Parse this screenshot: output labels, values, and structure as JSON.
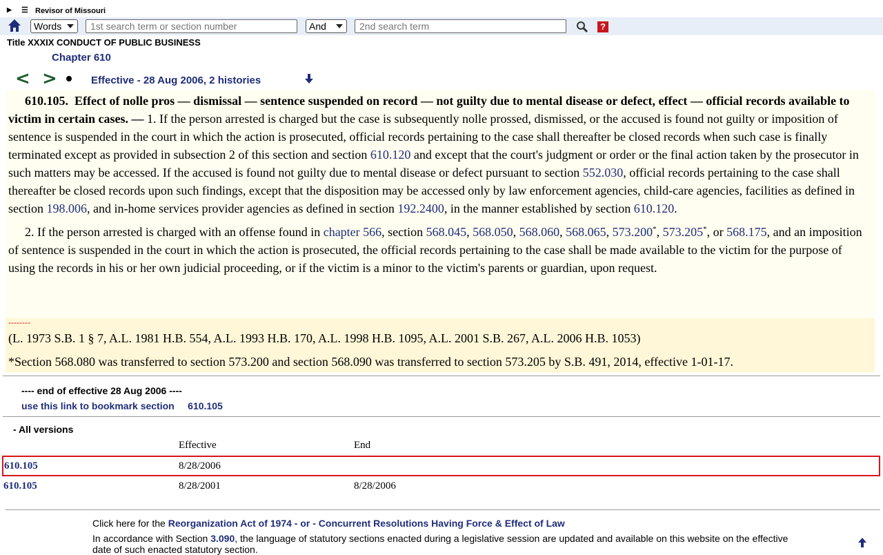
{
  "top": {
    "title": "Revisor of Missouri"
  },
  "search": {
    "mode_selected": "Words",
    "first_placeholder": "1st search term or section number",
    "operator_selected": "And",
    "second_placeholder": "2nd search term",
    "help_label": "?"
  },
  "heading": {
    "title": "Title XXXIX CONDUCT OF PUBLIC BUSINESS",
    "chapter": "Chapter 610"
  },
  "nav": {
    "prev": "<",
    "next": ">",
    "effective": "Effective - 28 Aug 2006, 2 histories"
  },
  "statute": {
    "section": "610.105.",
    "heading": "Effect of nolle pros — dismissal — sentence suspended on record — not guilty due to mental disease or defect, effect — official records available to victim in certain cases. —",
    "p1_a": " 1.  If the person arrested is charged but the case is subsequently nolle prossed, dismissed, or the accused is found not guilty or imposition of sentence is suspended in the court in which the action is prosecuted, official records pertaining to the case shall thereafter be closed records when such case is finally terminated except as provided in subsection 2 of this section and section ",
    "p1_link1": "610.120",
    "p1_b": " and except that the court's judgment or order or the final action taken by the prosecutor in such matters may be accessed.  If the accused is found not guilty due to mental disease or defect pursuant to section ",
    "p1_link2": "552.030",
    "p1_c": ", official records pertaining to the case shall thereafter be closed records upon such findings, except that the disposition may be accessed only by law enforcement agencies, child-care agencies, facilities as defined in section ",
    "p1_link3": "198.006",
    "p1_d": ", and in-home services provider agencies as defined in section ",
    "p1_link4": "192.2400",
    "p1_e": ", in the manner established by section ",
    "p1_link5": "610.120",
    "p1_f": ".",
    "p2_a": "2.  If the person arrested is charged with an offense found in ",
    "p2_link1": "chapter 566",
    "p2_b": ", section ",
    "p2_link2": "568.045",
    "p2_link3": "568.050",
    "p2_link4": "568.060",
    "p2_link5": "568.065",
    "p2_link6": "573.200",
    "p2_link7": "573.205",
    "p2_link8": "568.175",
    "p2_sep": ", ",
    "p2_or": ", or ",
    "p2_star": "*",
    "p2_c": ", and an imposition of sentence is suspended in the court in which the action is prosecuted, the official records pertaining to the case shall be made available to the victim for the purpose of using the records in his or her own judicial proceeding, or if the victim is a minor to the victim's parents or guardian, upon request."
  },
  "history": {
    "dashes": "--------",
    "acts": "(L. 1973 S.B. 1 § 7, A.L. 1981 H.B. 554, A.L. 1993 H.B. 170, A.L. 1998 H.B. 1095, A.L. 2001 S.B. 267, A.L. 2006 H.B. 1053)",
    "note": "*Section 568.080 was transferred to section 573.200 and section 568.090 was transferred to section 573.205 by S.B. 491, 2014, effective 1-01-17."
  },
  "endof": {
    "text": "---- end of effective    28 Aug 2006 ----",
    "bookmark_label": "use this link to bookmark section",
    "bookmark_section": "610.105"
  },
  "versions": {
    "toggle": "- All versions",
    "col_effective": "Effective",
    "col_end": "End",
    "rows": [
      {
        "section": "610.105",
        "effective": "8/28/2006",
        "end": ""
      },
      {
        "section": "610.105",
        "effective": "8/28/2001",
        "end": "8/28/2006"
      }
    ]
  },
  "footer": {
    "click_prefix": "Click here for the ",
    "click_link": "Reorganization Act of 1974 - or - Concurrent Resolutions Having Force & Effect of Law",
    "accord_prefix": "In accordance with Section ",
    "accord_link": "3.090",
    "accord_text": ", the language of statutory sections enacted during a legislative session are updated and available on this website on the effective date of such enacted statutory section."
  }
}
